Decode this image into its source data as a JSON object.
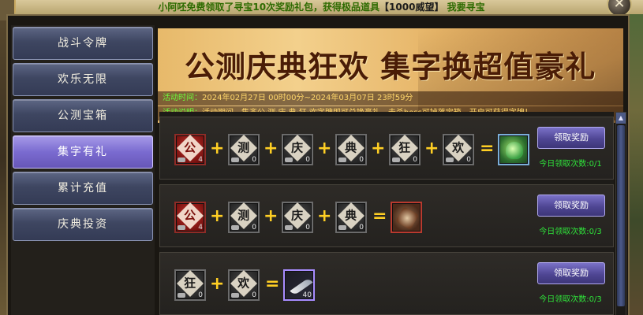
{
  "top_banner": {
    "prefix": "小阿呸免费领取了寻宝10次奖励礼包，获得极品道具",
    "item": "【1000威望】",
    "link": "我要寻宝"
  },
  "close_label": "✕",
  "sidebar": {
    "items": [
      {
        "label": "战斗令牌"
      },
      {
        "label": "欢乐无限"
      },
      {
        "label": "公测宝箱"
      },
      {
        "label": "集字有礼",
        "active": true
      },
      {
        "label": "累计充值"
      },
      {
        "label": "庆典投资"
      }
    ]
  },
  "header": {
    "title": "公测庆典狂欢  集字换超值豪礼",
    "time_label": "活动时间：",
    "time_value": "2024年02月27日 00时00分~2024年03月07日 23时59分",
    "desc_label": "活动说明：",
    "desc_value": "活动期间，集齐公·测·庆·典·狂·欢字牌即可兑换豪礼，击杀boss可掉落宝箱，开启可获得字牌！"
  },
  "rows": [
    {
      "inputs": [
        {
          "char": "公",
          "count": "4",
          "red": true
        },
        {
          "char": "测",
          "count": "0"
        },
        {
          "char": "庆",
          "count": "0"
        },
        {
          "char": "典",
          "count": "0"
        },
        {
          "char": "狂",
          "count": "0"
        },
        {
          "char": "欢",
          "count": "0"
        }
      ],
      "reward": "bag-icon",
      "button": "领取奖励",
      "claim_label": "今日领取次数:",
      "claim_value": "0/1"
    },
    {
      "inputs": [
        {
          "char": "公",
          "count": "4",
          "red": true
        },
        {
          "char": "测",
          "count": "0"
        },
        {
          "char": "庆",
          "count": "0"
        },
        {
          "char": "典",
          "count": "0"
        }
      ],
      "reward": "gem-icon",
      "button": "领取奖励",
      "claim_label": "今日领取次数:",
      "claim_value": "0/3"
    },
    {
      "inputs": [
        {
          "char": "狂",
          "count": "0"
        },
        {
          "char": "欢",
          "count": "0"
        }
      ],
      "reward": "blade-icon",
      "reward_count": "40",
      "button": "领取奖励",
      "claim_label": "今日领取次数:",
      "claim_value": "0/3"
    }
  ],
  "operators": {
    "plus": "+",
    "equals": "="
  },
  "scroll_up": "▲",
  "colors": {
    "button": "#4f4694",
    "active_tab": "#7a6bd0",
    "operator": "#ffcf24",
    "claim_text": "#2fe33a"
  }
}
